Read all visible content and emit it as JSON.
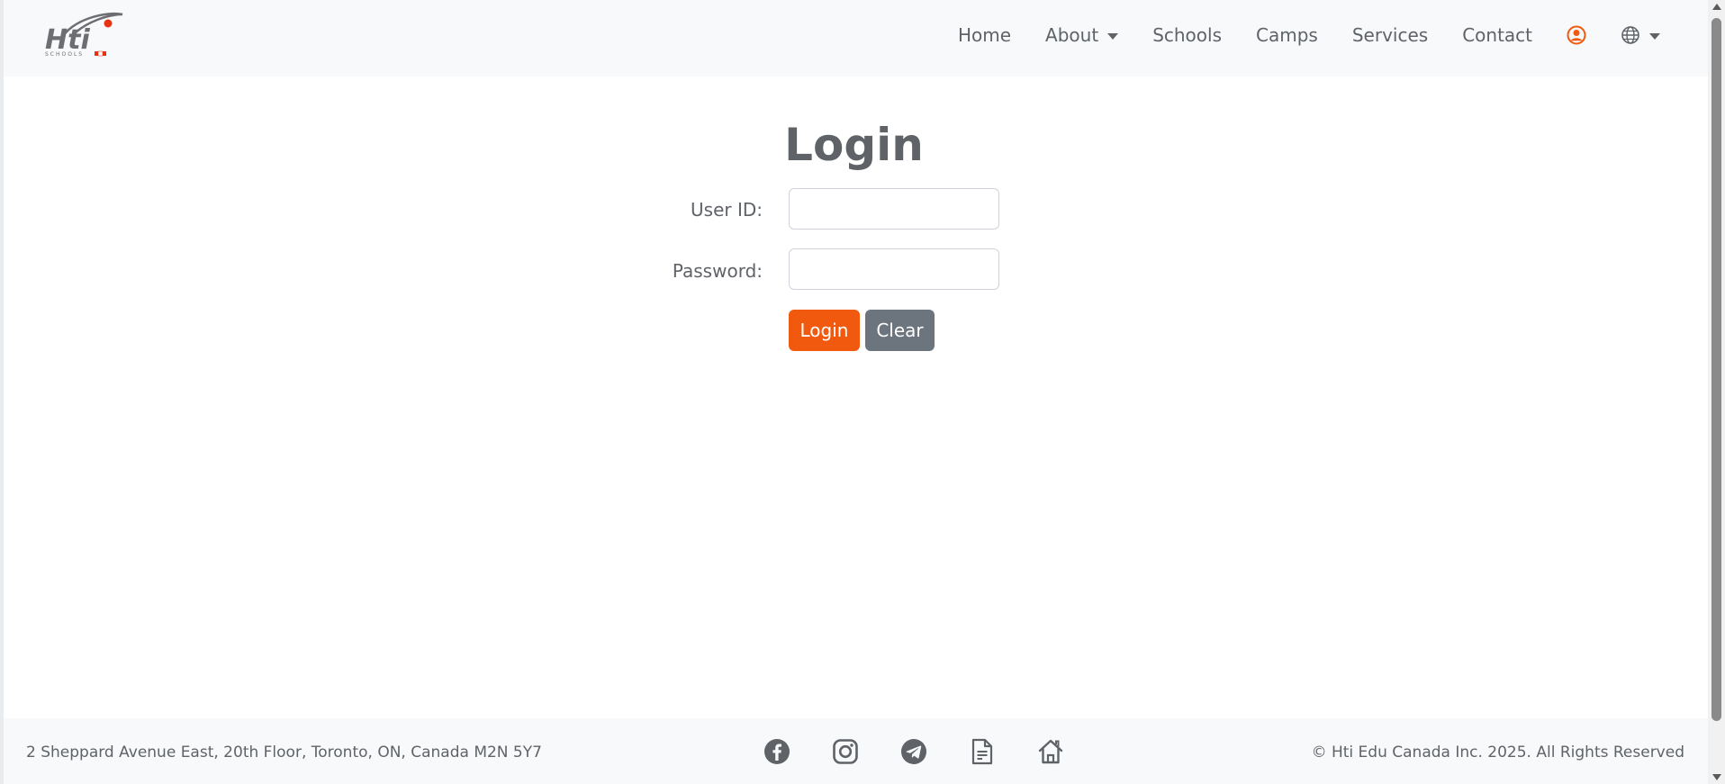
{
  "brand": {
    "logo_text": "Hti",
    "logo_subtext": "SCHOOLS"
  },
  "nav": {
    "items": [
      {
        "label": "Home"
      },
      {
        "label": "About"
      },
      {
        "label": "Schools"
      },
      {
        "label": "Camps"
      },
      {
        "label": "Services"
      },
      {
        "label": "Contact"
      }
    ],
    "user_icon": "user-circle-icon",
    "language_icon": "globe-icon"
  },
  "login": {
    "title": "Login",
    "user_id_label": "User ID:",
    "user_id_value": "",
    "password_label": "Password:",
    "password_value": "",
    "login_button": "Login",
    "clear_button": "Clear"
  },
  "footer": {
    "address": "2 Sheppard Avenue East, 20th Floor, Toronto, ON, Canada M2N 5Y7",
    "copyright": "© Hti Edu Canada Inc. 2025. All Rights Reserved",
    "icons": [
      "facebook-icon",
      "instagram-icon",
      "telegram-icon",
      "document-icon",
      "home-icon"
    ]
  },
  "colors": {
    "accent": "#f15a0e",
    "secondary": "#6c757d",
    "text": "#5f6368",
    "navbar_bg": "#f8f9fa"
  }
}
